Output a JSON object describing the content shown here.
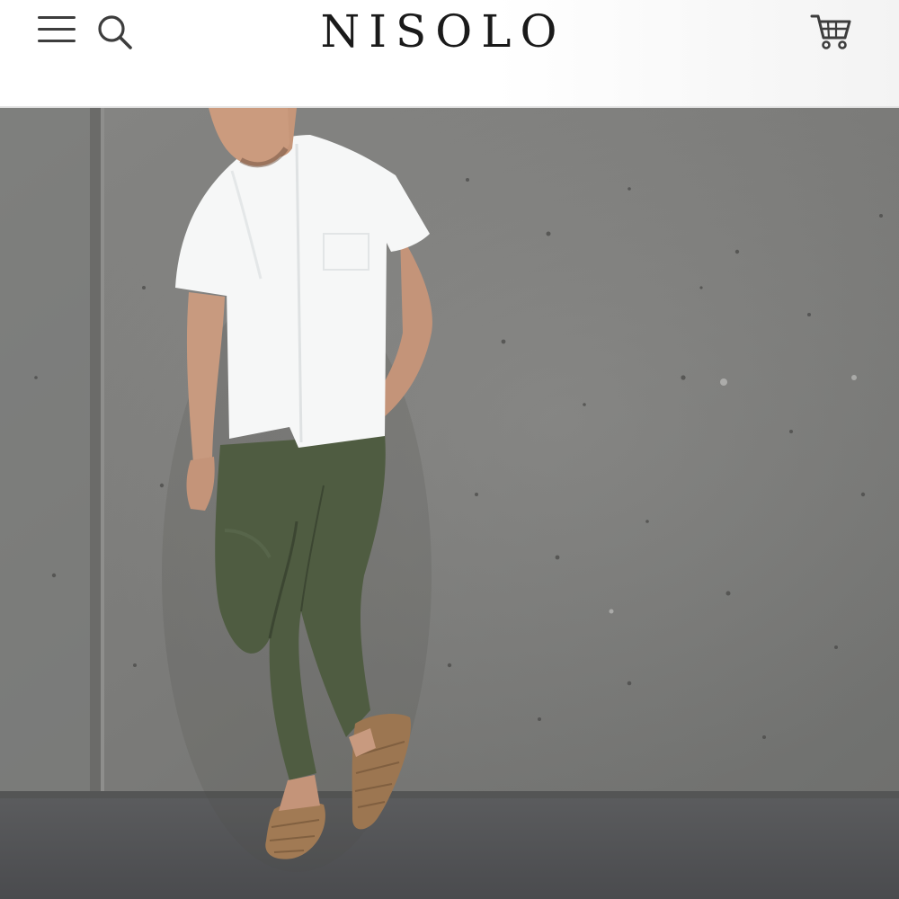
{
  "header": {
    "logo_text": "NISOLO",
    "menu_icon": "hamburger-menu-icon",
    "search_icon": "search-icon",
    "cart_icon": "shopping-cart-icon"
  },
  "colors": {
    "header_bg": "#ffffff",
    "logo": "#1a1a1a",
    "icon": "#3d3d3d",
    "wall": "#7c7c7a",
    "shirt": "#f7f8f8",
    "pants": "#4d5a3f",
    "shoes": "#9a7450"
  }
}
